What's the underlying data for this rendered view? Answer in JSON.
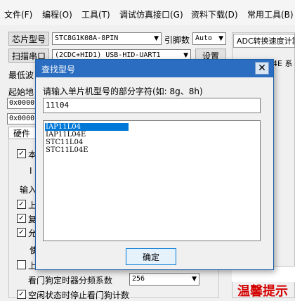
{
  "menu": [
    "文件(F)",
    "编程(O)",
    "工具(T)",
    "调试仿真接口(G)",
    "资料下载(D)",
    "常用工具(B)"
  ],
  "toolbar": {
    "chip_button": "芯片型号",
    "chip_value": "STC8G1K08A-8PIN",
    "pin_label": "引脚数",
    "pin_value": "Auto",
    "scan_button": "扫描串口",
    "port_value": "(2CDC+HID1) USB-HID-UART1",
    "settings_button": "设置"
  },
  "left": {
    "label_lowest": "最低波",
    "label_start": "起始地",
    "hex1": "0x0000",
    "hex2": "0x0000",
    "group_label": "硬件",
    "hw_row1": "本",
    "hw_row1b": "I",
    "hw_label_input": "输入",
    "hw_row2": "上",
    "hw_row3": "复",
    "hw_row4": "允",
    "hw_row4b": "使",
    "hw_row5": "上",
    "wdt_label": "看门狗定时器分频系数",
    "wdt_value": "256",
    "idle_label": "空闲状态时停止看门狗计数"
  },
  "right": {
    "tab": "ADC转换速度计算",
    "item": "4E 系",
    "red_text": "温馨提示"
  },
  "dialog": {
    "title": "查找型号",
    "close": "✕",
    "prompt": "请输入单片机型号的部分字符(如: 8g、8h)",
    "input_value": "11l04",
    "results": [
      "IAP11L04",
      "IAP11L04E",
      "STC11L04",
      "STC11L04E"
    ],
    "selected_index": 0,
    "ok_button": "确定"
  }
}
